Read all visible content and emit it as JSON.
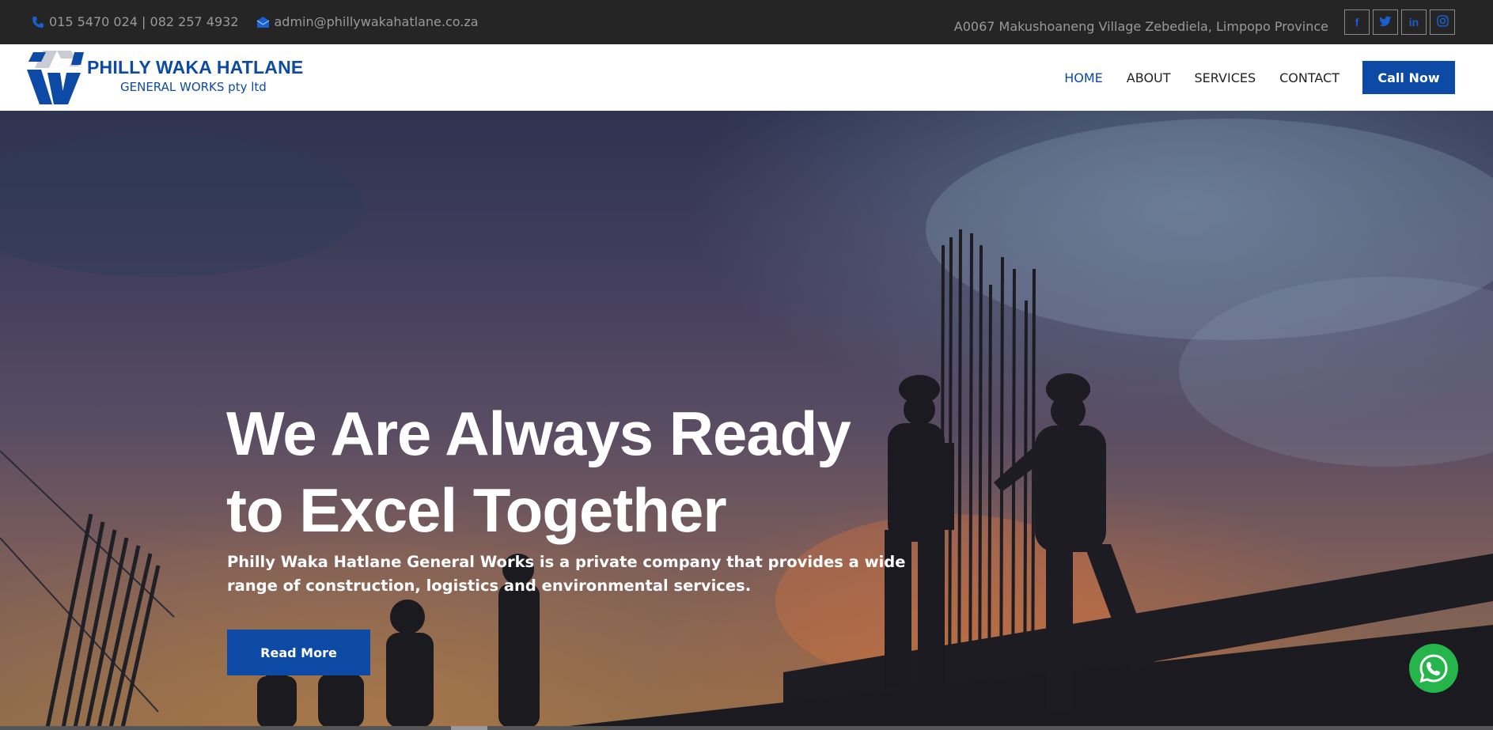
{
  "topbar": {
    "phone": "015 5470 024 | 082 257 4932",
    "email": "admin@phillywakahatlane.co.za",
    "address": "A0067 Makushoaneng Village Zebediela, Limpopo Province",
    "socials": [
      {
        "glyph": "f",
        "icon": "facebook-icon"
      },
      {
        "glyph": "t",
        "icon": "twitter-icon"
      },
      {
        "glyph": "in",
        "icon": "linkedin-icon"
      },
      {
        "glyph": "",
        "icon": "instagram-icon"
      }
    ]
  },
  "brand": {
    "name": "PHILLY WAKA HATLANE",
    "tagline": "GENERAL WORKS pty ltd",
    "color": "#0c4aa6"
  },
  "nav": {
    "items": [
      {
        "label": "HOME",
        "active": true
      },
      {
        "label": "ABOUT",
        "active": false
      },
      {
        "label": "SERVICES",
        "active": false
      },
      {
        "label": "CONTACT",
        "active": false
      }
    ],
    "cta": "Call Now"
  },
  "hero": {
    "title_line1": "We Are Always Ready",
    "title_line2": "to Excel Together",
    "description": "Philly Waka Hatlane General Works is a private company that provides a wide range of construction, logistics and environmental services.",
    "button": "Read More"
  },
  "colors": {
    "topbar_bg": "#252525",
    "accent": "#0c4aa6",
    "whatsapp": "#25b54a"
  }
}
